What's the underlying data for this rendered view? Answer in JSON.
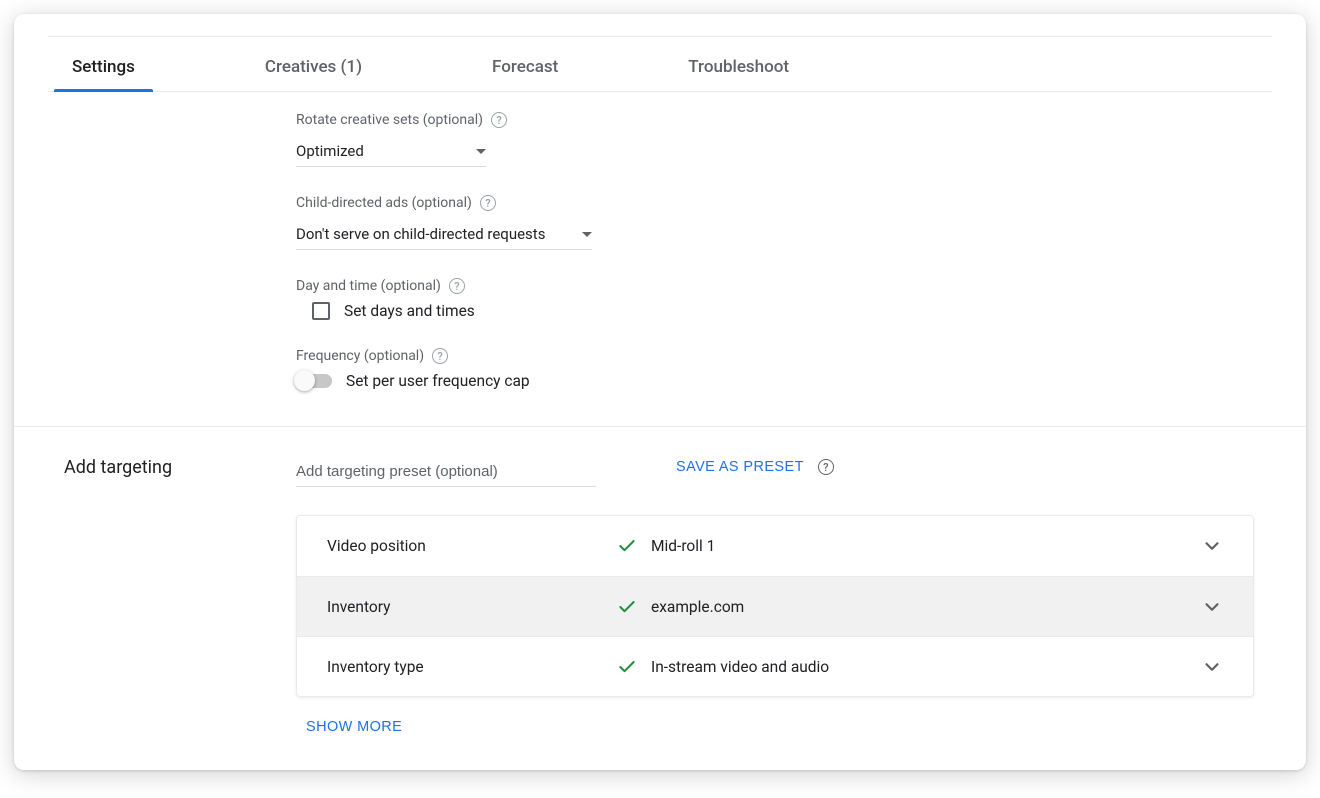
{
  "tabs": {
    "settings": "Settings",
    "creatives": "Creatives (1)",
    "forecast": "Forecast",
    "troubleshoot": "Troubleshoot"
  },
  "fields": {
    "rotate_label": "Rotate creative sets (optional)",
    "rotate_value": "Optimized",
    "child_label": "Child-directed ads (optional)",
    "child_value": "Don't serve on child-directed requests",
    "daytime_label": "Day and time (optional)",
    "daytime_checkbox": "Set days and times",
    "frequency_label": "Frequency (optional)",
    "frequency_toggle": "Set per user frequency cap"
  },
  "targeting": {
    "section_title": "Add targeting",
    "preset_placeholder": "Add targeting preset (optional)",
    "save_preset": "SAVE AS PRESET",
    "rows": [
      {
        "name": "Video position",
        "value": "Mid-roll 1"
      },
      {
        "name": "Inventory",
        "value": "example.com"
      },
      {
        "name": "Inventory type",
        "value": "In-stream video and audio"
      }
    ],
    "show_more": "SHOW MORE"
  }
}
